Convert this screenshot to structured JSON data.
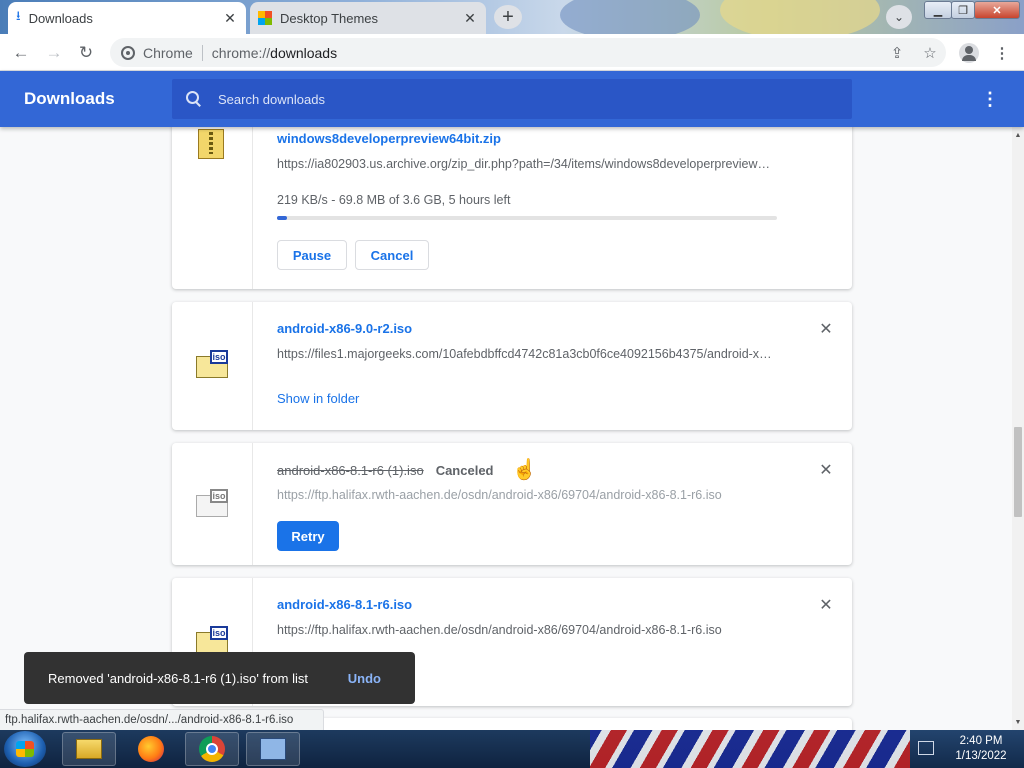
{
  "tabs": [
    {
      "title": "Downloads",
      "active": true
    },
    {
      "title": "Desktop Themes",
      "active": false
    }
  ],
  "window_buttons": {
    "minimize": "▁",
    "maximize": "❐",
    "close": "✕"
  },
  "toolbar": {
    "site_label": "Chrome",
    "url_scheme": "chrome://",
    "url_host": "downloads"
  },
  "downloads_header": {
    "title": "Downloads",
    "search_placeholder": "Search downloads"
  },
  "downloads": [
    {
      "file_name": "windows8developerpreview64bit.zip",
      "url": "https://ia802903.us.archive.org/zip_dir.php?path=/34/items/windows8developerpreview64bit.zip",
      "progress_text": "219 KB/s - 69.8 MB of 3.6 GB, 5 hours left",
      "progress_fraction": 0.019,
      "pause_label": "Pause",
      "cancel_label": "Cancel"
    },
    {
      "file_name": "android-x86-9.0-r2.iso",
      "url": "https://files1.majorgeeks.com/10afebdbffcd4742c81a3cb0f6ce4092156b4375/android-x86-9.0-r2.iso",
      "action_label": "Show in folder"
    },
    {
      "file_name": "android-x86-8.1-r6 (1).iso",
      "status": "Canceled",
      "url": "https://ftp.halifax.rwth-aachen.de/osdn/android-x86/69704/android-x86-8.1-r6.iso",
      "action_label": "Retry"
    },
    {
      "file_name": "android-x86-8.1-r6.iso",
      "url": "https://ftp.halifax.rwth-aachen.de/osdn/android-x86/69704/android-x86-8.1-r6.iso"
    }
  ],
  "toast": {
    "message": "Removed 'android-x86-8.1-r6 (1).iso' from list",
    "undo_label": "Undo"
  },
  "status_bubble": "ftp.halifax.rwth-aachen.de/osdn/.../android-x86-8.1-r6.iso",
  "taskbar": {
    "time": "2:40 PM",
    "date": "1/13/2022"
  },
  "colors": {
    "header_blue": "#3367d6",
    "link_blue": "#1a73e8",
    "toast_bg": "#323232"
  }
}
